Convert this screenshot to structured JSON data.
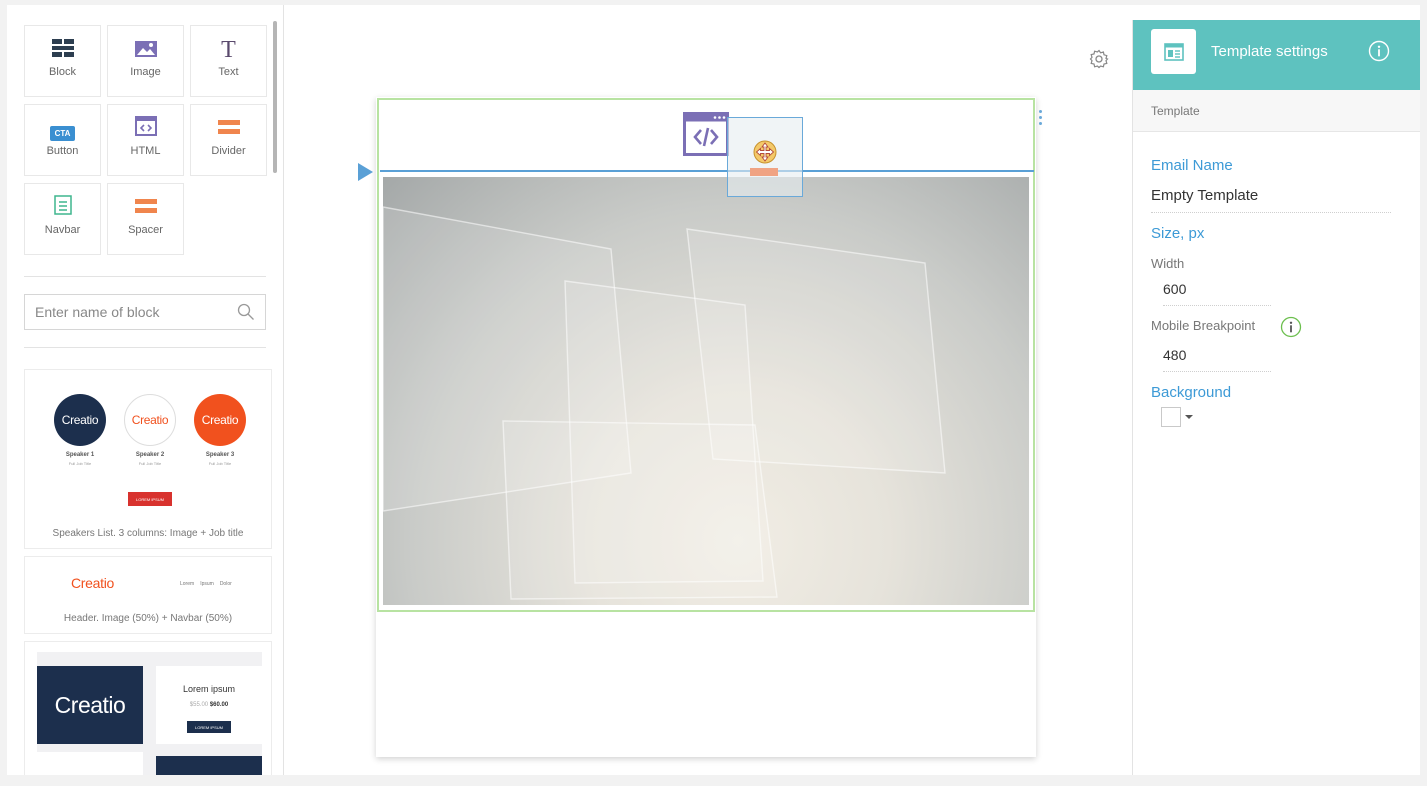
{
  "blocks": {
    "block": "Block",
    "image": "Image",
    "text": "Text",
    "text_glyph": "T",
    "button": "Button",
    "button_badge": "CTA",
    "html": "HTML",
    "divider": "Divider",
    "navbar": "Navbar",
    "spacer": "Spacer"
  },
  "search": {
    "placeholder": "Enter name of block"
  },
  "templates": {
    "speakers": {
      "title": "Speakers List. 3 columns: Image + Job title",
      "logo": "Creatio",
      "names": [
        "Speaker 1",
        "Speaker 2",
        "Speaker 3"
      ],
      "job": "Full Job Title",
      "button": "LOREM IPSUM"
    },
    "header": {
      "title": "Header. Image (50%) + Navbar (50%)",
      "logo": "Creatio",
      "nav": [
        "Lorem",
        "Ipsum",
        "Dolor"
      ]
    },
    "product": {
      "logo": "Creatio",
      "heading": "Lorem ipsum",
      "old_price": "$55.00",
      "price": "$60.00",
      "button": "LOREM IPSUM"
    }
  },
  "settings": {
    "title": "Template settings",
    "section": "Template",
    "email_name_label": "Email Name",
    "email_name": "Empty Template",
    "size_label": "Size, px",
    "width_label": "Width",
    "width": "600",
    "breakpoint_label": "Mobile Breakpoint",
    "breakpoint": "480",
    "background_label": "Background"
  },
  "colors": {
    "accent_teal": "#5ec2bf",
    "link_blue": "#3d9ad6",
    "creatio_navy": "#1c2f4d",
    "creatio_orange": "#f1511e"
  }
}
